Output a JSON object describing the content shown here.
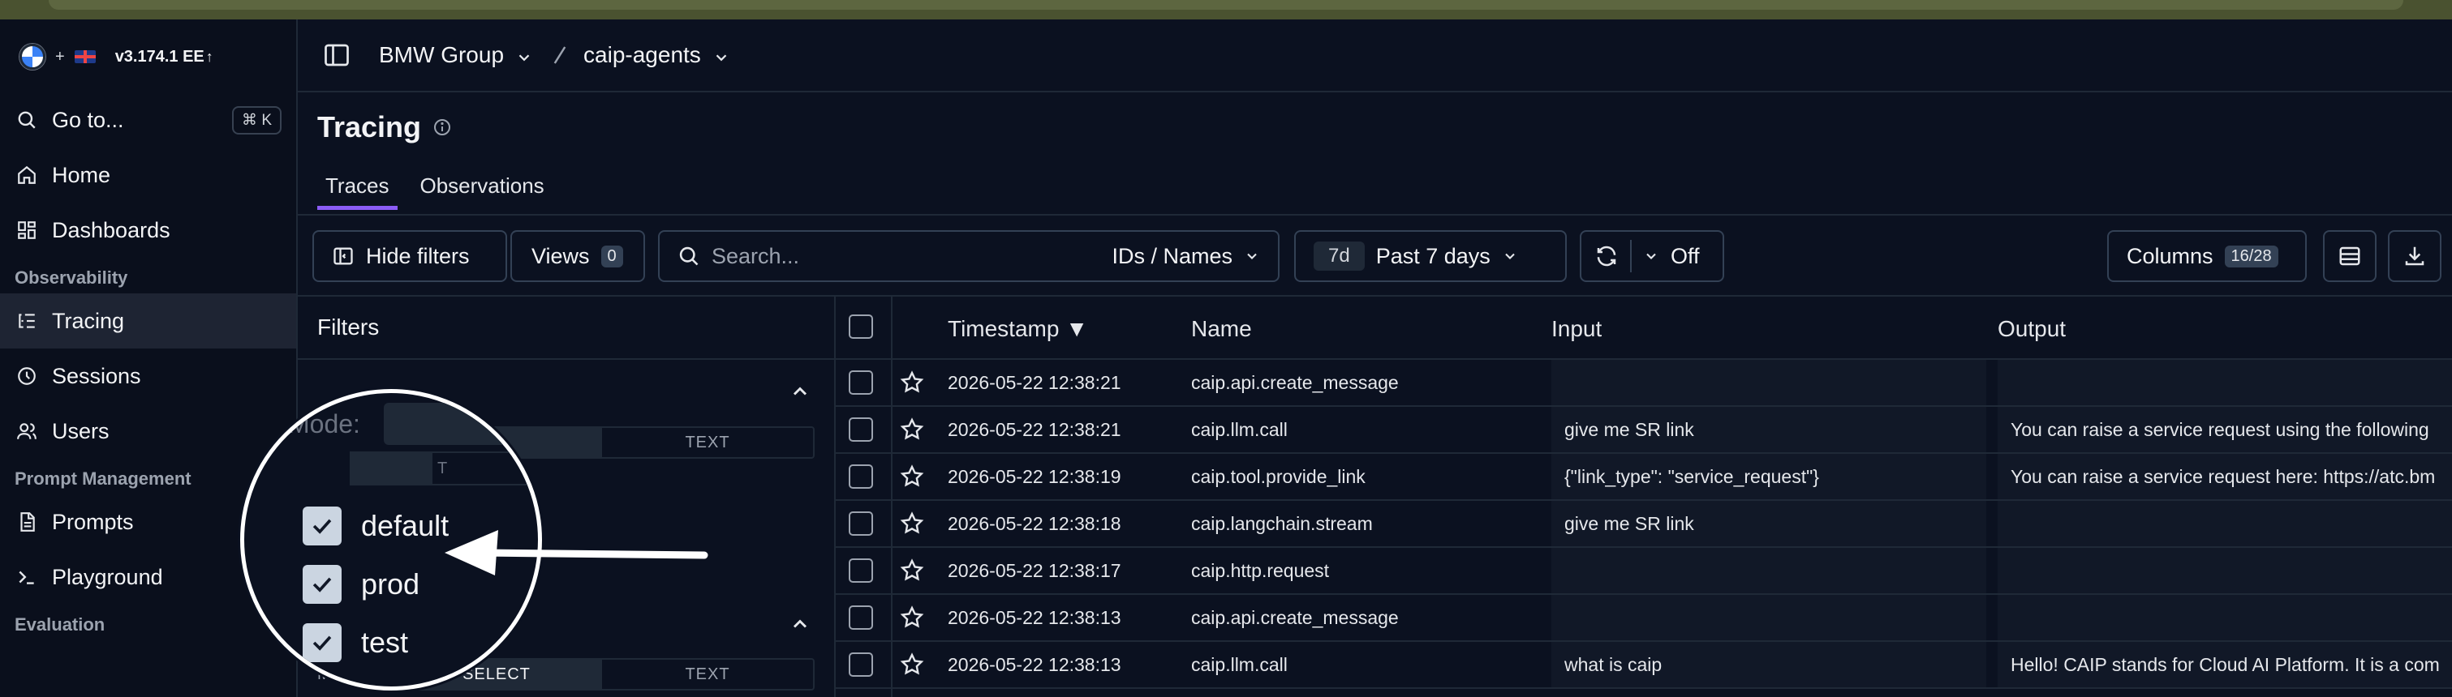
{
  "app": {
    "version": "v3.174.1 EE",
    "org": "BMW Group",
    "project": "caip-agents"
  },
  "sidebar": {
    "goto": {
      "label": "Go to...",
      "shortcut": "⌘ K"
    },
    "items": [
      {
        "label": "Home"
      },
      {
        "label": "Dashboards"
      }
    ],
    "sections": [
      {
        "label": "Observability",
        "items": [
          {
            "label": "Tracing"
          },
          {
            "label": "Sessions"
          },
          {
            "label": "Users"
          }
        ]
      },
      {
        "label": "Prompt Management",
        "items": [
          {
            "label": "Prompts"
          },
          {
            "label": "Playground"
          }
        ]
      },
      {
        "label": "Evaluation"
      }
    ]
  },
  "page": {
    "title": "Tracing",
    "tabs": [
      {
        "label": "Traces"
      },
      {
        "label": "Observations"
      }
    ]
  },
  "toolbar": {
    "hide_filters": "Hide filters",
    "views_label": "Views",
    "views_count": "0",
    "search_placeholder": "Search...",
    "search_scope": "IDs / Names",
    "date_short": "7d",
    "date_label": "Past 7 days",
    "refresh_label": "Off",
    "columns_label": "Columns",
    "columns_count": "16/28"
  },
  "filters": {
    "title": "Filters",
    "mode_label": "Mode:",
    "select_label": "SELECT",
    "text_label": "TEXT",
    "mode_partial": "Mode:"
  },
  "magnifier": {
    "mode_label": "Mode:",
    "text_label": "T",
    "options": [
      "default",
      "prod",
      "test"
    ]
  },
  "table": {
    "headers": {
      "timestamp": "Timestamp ▼",
      "name": "Name",
      "input": "Input",
      "output": "Output"
    },
    "rows": [
      {
        "timestamp": "2026-05-22 12:38:21",
        "name": "caip.api.create_message",
        "input": "",
        "output": ""
      },
      {
        "timestamp": "2026-05-22 12:38:21",
        "name": "caip.llm.call",
        "input": "give me SR link",
        "output": "You can raise a service request using the following"
      },
      {
        "timestamp": "2026-05-22 12:38:19",
        "name": "caip.tool.provide_link",
        "input": "{\"link_type\": \"service_request\"}",
        "output": "You can raise a service request here: https://atc.bm"
      },
      {
        "timestamp": "2026-05-22 12:38:18",
        "name": "caip.langchain.stream",
        "input": "give me SR link",
        "output": ""
      },
      {
        "timestamp": "2026-05-22 12:38:17",
        "name": "caip.http.request",
        "input": "",
        "output": ""
      },
      {
        "timestamp": "2026-05-22 12:38:13",
        "name": "caip.api.create_message",
        "input": "",
        "output": ""
      },
      {
        "timestamp": "2026-05-22 12:38:13",
        "name": "caip.llm.call",
        "input": "what is caip",
        "output": "Hello! CAIP stands for Cloud AI Platform. It is a com"
      }
    ]
  },
  "colors": {
    "background": "#0b1120",
    "accent": "#8b5cf6",
    "border": "#1f2937"
  }
}
